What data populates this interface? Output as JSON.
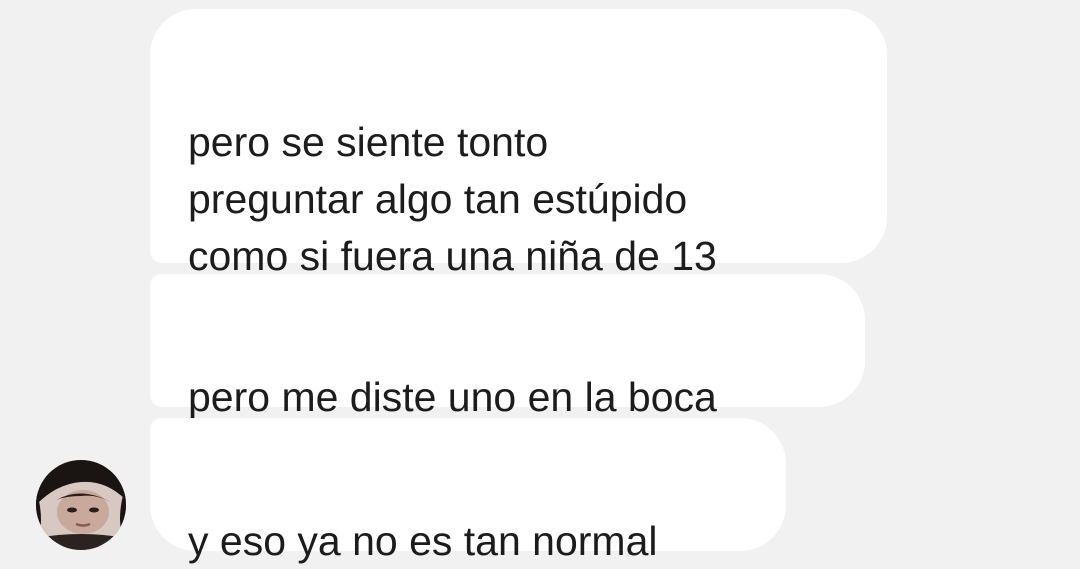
{
  "chat": {
    "messages": [
      {
        "text": "pero se siente tonto\npreguntar algo tan estúpido\ncomo si fuera una niña de 13"
      },
      {
        "text": "pero me diste uno en la boca"
      },
      {
        "text": "y eso ya no es tan normal"
      }
    ],
    "colors": {
      "background": "#f1f1f1",
      "bubble": "#ffffff",
      "text": "#1c1c1c"
    },
    "avatar_icon": "profile-photo"
  }
}
